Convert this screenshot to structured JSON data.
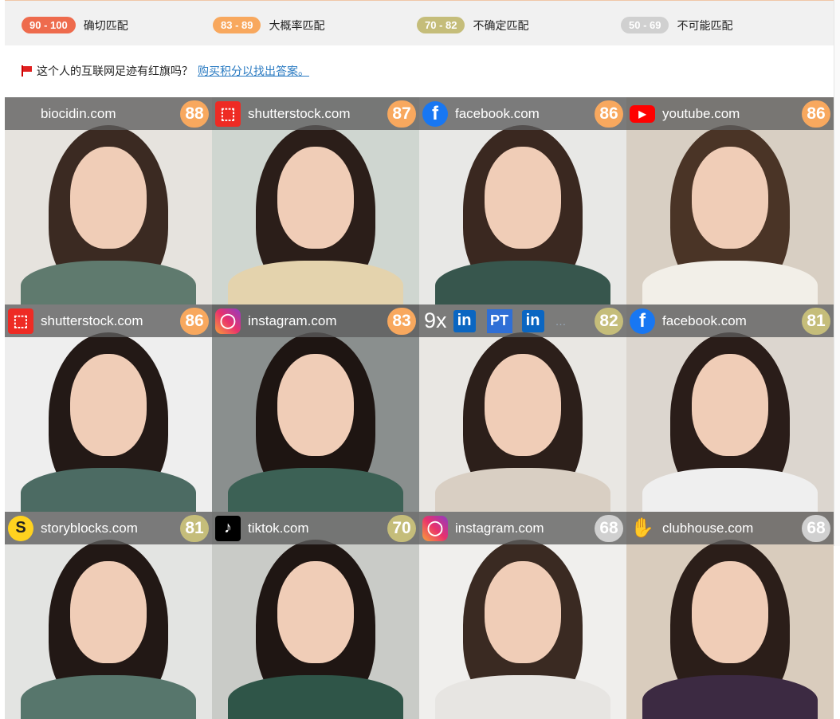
{
  "legend": [
    {
      "range": "90 - 100",
      "label": "确切匹配",
      "color": "#ee6b4d"
    },
    {
      "range": "83 - 89",
      "label": "大概率匹配",
      "color": "#f8a85e"
    },
    {
      "range": "70 - 82",
      "label": "不确定匹配",
      "color": "#c5bd7a"
    },
    {
      "range": "50 - 69",
      "label": "不可能匹配",
      "color": "#d0d0d0"
    }
  ],
  "redflag": {
    "question": "这个人的互联网足迹有红旗吗？",
    "link": "购买积分以找出答案。"
  },
  "results": [
    {
      "site": "biocidin.com",
      "score": "88",
      "icon": "none",
      "score_color": "#f8a85e"
    },
    {
      "site": "shutterstock.com",
      "score": "87",
      "icon": "shutterstock-icon",
      "score_color": "#f8a85e"
    },
    {
      "site": "facebook.com",
      "score": "86",
      "icon": "facebook-icon",
      "score_color": "#f8a85e"
    },
    {
      "site": "youtube.com",
      "score": "86",
      "icon": "youtube-icon",
      "score_color": "#f8a85e"
    },
    {
      "site": "shutterstock.com",
      "score": "86",
      "icon": "shutterstock-icon",
      "score_color": "#f8a85e"
    },
    {
      "site": "instagram.com",
      "score": "83",
      "icon": "instagram-icon",
      "score_color": "#f8a85e"
    },
    {
      "site": "",
      "multi_count": "9x",
      "score": "82",
      "icon": "multi-icons",
      "score_color": "#c5bd7a"
    },
    {
      "site": "facebook.com",
      "score": "81",
      "icon": "facebook-icon",
      "score_color": "#c5bd7a"
    },
    {
      "site": "storyblocks.com",
      "score": "81",
      "icon": "storyblocks-icon",
      "score_color": "#c5bd7a"
    },
    {
      "site": "tiktok.com",
      "score": "70",
      "icon": "tiktok-icon",
      "score_color": "#c5bd7a"
    },
    {
      "site": "instagram.com",
      "score": "68",
      "icon": "instagram-icon",
      "score_color": "#d0d0d0"
    },
    {
      "site": "clubhouse.com",
      "score": "68",
      "icon": "clubhouse-icon",
      "score_color": "#d0d0d0"
    }
  ]
}
